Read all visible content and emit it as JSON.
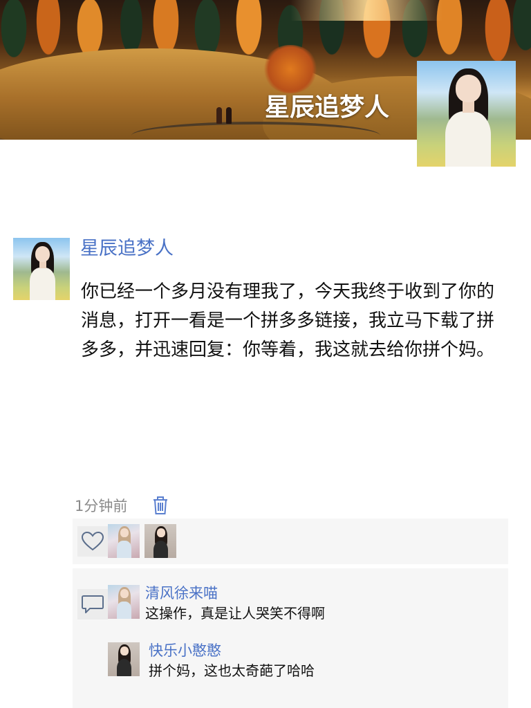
{
  "cover": {
    "display_name": "星辰追梦人"
  },
  "post": {
    "author": "星辰追梦人",
    "body": "你已经一个多月没有理我了，今天我终于收到了你的消息，打开一看是一个拼多多链接，我立马下载了拼多多，并迅速回复：你等着，我这就去给你拼个妈。",
    "time": "1分钟前"
  },
  "likes": {
    "icon": "heart-icon",
    "users": [
      "avatar-1",
      "avatar-2"
    ]
  },
  "comments": [
    {
      "author": "清风徐来喵",
      "text": "这操作，真是让人哭笑不得啊"
    },
    {
      "author": "快乐小憨憨",
      "text": "拼个妈，这也太奇葩了哈哈"
    }
  ],
  "icons": {
    "delete": "trash-icon",
    "comment": "comment-icon"
  },
  "colors": {
    "link": "#4a72c6",
    "muted": "#8a8a8a",
    "panel": "#f6f6f6"
  }
}
